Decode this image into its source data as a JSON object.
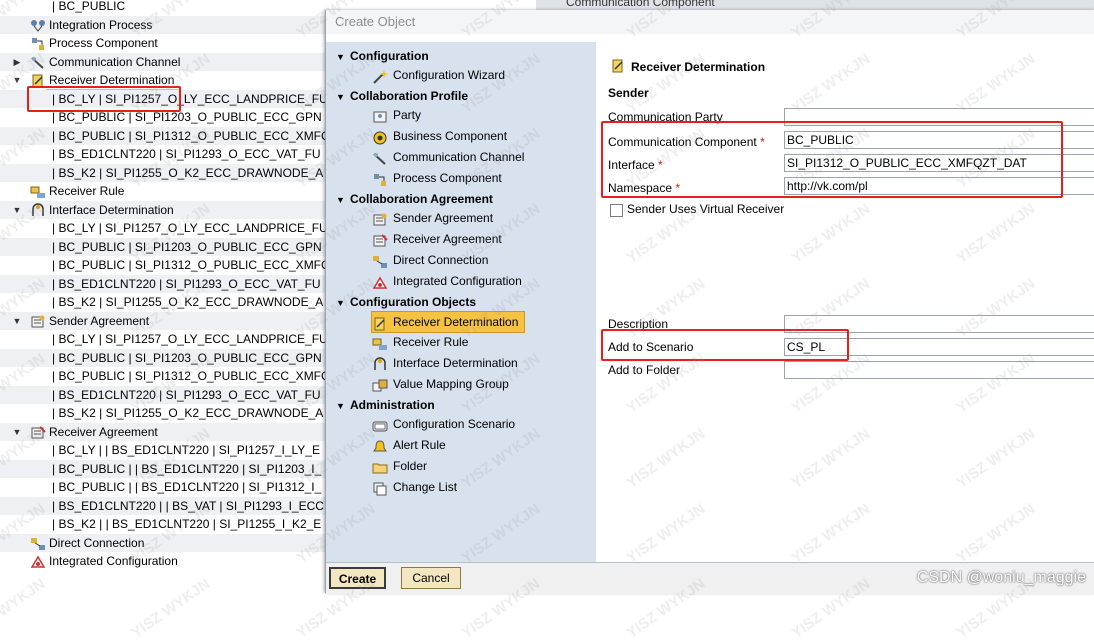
{
  "tree": {
    "rows": [
      {
        "type": "child",
        "text": "| BC_PUBLIC"
      },
      {
        "type": "node",
        "text": "Integration Process",
        "icon": "integration-process-icon"
      },
      {
        "type": "node",
        "text": "Process Component",
        "icon": "process-component-icon"
      },
      {
        "type": "node",
        "text": "Communication Channel",
        "icon": "communication-channel-icon",
        "arrow": "▶"
      },
      {
        "type": "node",
        "text": "Receiver Determination",
        "icon": "receiver-determination-icon",
        "arrow": "▼",
        "selected": true
      },
      {
        "type": "child",
        "text": "| BC_LY | SI_PI1257_O_LY_ECC_LANDPRICE_FU"
      },
      {
        "type": "child",
        "text": "| BC_PUBLIC | SI_PI1203_O_PUBLIC_ECC_GPN"
      },
      {
        "type": "child",
        "text": "| BC_PUBLIC | SI_PI1312_O_PUBLIC_ECC_XMFC"
      },
      {
        "type": "child",
        "text": "| BS_ED1CLNT220 | SI_PI1293_O_ECC_VAT_FU"
      },
      {
        "type": "child",
        "text": "| BS_K2 | SI_PI1255_O_K2_ECC_DRAWNODE_A"
      },
      {
        "type": "node",
        "text": "Receiver Rule",
        "icon": "receiver-rule-icon"
      },
      {
        "type": "node",
        "text": "Interface Determination",
        "icon": "interface-determination-icon",
        "arrow": "▼"
      },
      {
        "type": "child",
        "text": "| BC_LY | SI_PI1257_O_LY_ECC_LANDPRICE_FU"
      },
      {
        "type": "child",
        "text": "| BC_PUBLIC | SI_PI1203_O_PUBLIC_ECC_GPN"
      },
      {
        "type": "child",
        "text": "| BC_PUBLIC | SI_PI1312_O_PUBLIC_ECC_XMFC"
      },
      {
        "type": "child",
        "text": "| BS_ED1CLNT220 | SI_PI1293_O_ECC_VAT_FU"
      },
      {
        "type": "child",
        "text": "| BS_K2 | SI_PI1255_O_K2_ECC_DRAWNODE_A"
      },
      {
        "type": "node",
        "text": "Sender Agreement",
        "icon": "sender-agreement-icon",
        "arrow": "▼"
      },
      {
        "type": "child",
        "text": "| BC_LY | SI_PI1257_O_LY_ECC_LANDPRICE_FU"
      },
      {
        "type": "child",
        "text": "| BC_PUBLIC | SI_PI1203_O_PUBLIC_ECC_GPN"
      },
      {
        "type": "child",
        "text": "| BC_PUBLIC | SI_PI1312_O_PUBLIC_ECC_XMFC"
      },
      {
        "type": "child",
        "text": "| BS_ED1CLNT220 | SI_PI1293_O_ECC_VAT_FU"
      },
      {
        "type": "child",
        "text": "| BS_K2 | SI_PI1255_O_K2_ECC_DRAWNODE_A"
      },
      {
        "type": "node",
        "text": "Receiver Agreement",
        "icon": "receiver-agreement-icon",
        "arrow": "▼"
      },
      {
        "type": "child",
        "text": "| BC_LY | | BS_ED1CLNT220 | SI_PI1257_I_LY_E"
      },
      {
        "type": "child",
        "text": "| BC_PUBLIC | | BS_ED1CLNT220 | SI_PI1203_I_"
      },
      {
        "type": "child",
        "text": "| BC_PUBLIC | | BS_ED1CLNT220 | SI_PI1312_I_"
      },
      {
        "type": "child",
        "text": "| BS_ED1CLNT220 | | BS_VAT | SI_PI1293_I_ECC"
      },
      {
        "type": "child",
        "text": "| BS_K2 | | BS_ED1CLNT220 | SI_PI1255_I_K2_E"
      },
      {
        "type": "node",
        "text": "Direct Connection",
        "icon": "direct-connection-icon"
      },
      {
        "type": "node",
        "text": "Integrated Configuration",
        "icon": "integrated-configuration-icon"
      }
    ]
  },
  "background": {
    "tab_label": "Communication Component"
  },
  "dialog": {
    "title": "Create Object",
    "nav": [
      {
        "group": "Configuration",
        "items": [
          {
            "label": "Configuration Wizard",
            "icon": "wizard-icon"
          }
        ]
      },
      {
        "group": "Collaboration Profile",
        "items": [
          {
            "label": "Party",
            "icon": "party-icon"
          },
          {
            "label": "Business Component",
            "icon": "business-component-icon"
          },
          {
            "label": "Communication Channel",
            "icon": "communication-channel-icon"
          },
          {
            "label": "Process Component",
            "icon": "process-component-icon"
          }
        ]
      },
      {
        "group": "Collaboration Agreement",
        "items": [
          {
            "label": "Sender Agreement",
            "icon": "sender-agreement-icon"
          },
          {
            "label": "Receiver Agreement",
            "icon": "receiver-agreement-icon"
          },
          {
            "label": "Direct Connection",
            "icon": "direct-connection-icon"
          },
          {
            "label": "Integrated Configuration",
            "icon": "integrated-configuration-icon"
          }
        ]
      },
      {
        "group": "Configuration Objects",
        "items": [
          {
            "label": "Receiver Determination",
            "icon": "receiver-determination-icon",
            "selected": true
          },
          {
            "label": "Receiver Rule",
            "icon": "receiver-rule-icon"
          },
          {
            "label": "Interface Determination",
            "icon": "interface-determination-icon"
          },
          {
            "label": "Value Mapping Group",
            "icon": "value-mapping-icon"
          }
        ]
      },
      {
        "group": "Administration",
        "items": [
          {
            "label": "Configuration Scenario",
            "icon": "configuration-scenario-icon"
          },
          {
            "label": "Alert Rule",
            "icon": "alert-rule-icon"
          },
          {
            "label": "Folder",
            "icon": "folder-icon"
          },
          {
            "label": "Change List",
            "icon": "change-list-icon"
          }
        ]
      }
    ],
    "form": {
      "heading": "Receiver Determination",
      "sender_heading": "Sender",
      "communication_party_label": "Communication Party",
      "communication_party_value": "",
      "communication_component_label": "Communication Component",
      "communication_component_value": "BC_PUBLIC",
      "interface_label": "Interface",
      "interface_value": "SI_PI1312_O_PUBLIC_ECC_XMFQZT_DAT",
      "namespace_label": "Namespace",
      "namespace_value": "http://vk.com/pl",
      "required_marker": "*",
      "virtual_receiver_label": "Sender Uses Virtual Receiver",
      "description_label": "Description",
      "description_value": "",
      "scenario_label": "Add to Scenario",
      "scenario_value": "CS_PL",
      "folder_label": "Add to Folder",
      "folder_value": ""
    },
    "buttons": {
      "create": "Create",
      "cancel": "Cancel"
    }
  },
  "watermark": "CSDN @woniu_maggie",
  "colors": {
    "selection": "#f5c242",
    "highlight_box": "#e8201c",
    "nav_bg": "#d7e2ee",
    "button_bg": "#f2e7c0"
  }
}
